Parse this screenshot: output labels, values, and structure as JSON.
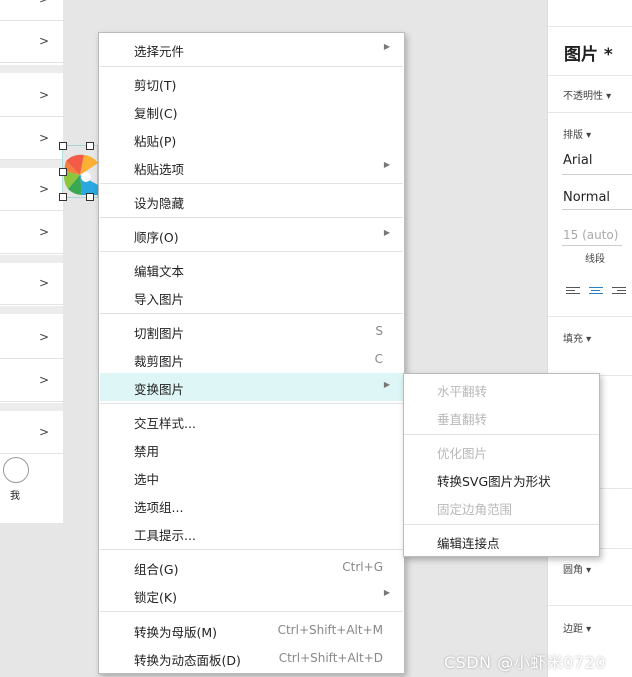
{
  "left_list": {
    "rows": [
      ">",
      ">",
      ">",
      ">",
      ">",
      ">",
      ">",
      ">",
      ">",
      ">"
    ],
    "me_label": "我"
  },
  "context_menu": {
    "items": [
      {
        "label": "选择元件",
        "shortcut": "",
        "submenu": true
      },
      {
        "label": "剪切(T)",
        "shortcut": "",
        "submenu": false
      },
      {
        "label": "复制(C)",
        "shortcut": "",
        "submenu": false
      },
      {
        "label": "粘贴(P)",
        "shortcut": "",
        "submenu": false
      },
      {
        "label": "粘贴选项",
        "shortcut": "",
        "submenu": true
      },
      {
        "label": "设为隐藏",
        "shortcut": "",
        "submenu": false
      },
      {
        "label": "顺序(O)",
        "shortcut": "",
        "submenu": true
      },
      {
        "label": "编辑文本",
        "shortcut": "",
        "submenu": false
      },
      {
        "label": "导入图片",
        "shortcut": "",
        "submenu": false
      },
      {
        "label": "切割图片",
        "shortcut": "S",
        "submenu": false
      },
      {
        "label": "裁剪图片",
        "shortcut": "C",
        "submenu": false
      },
      {
        "label": "变换图片",
        "shortcut": "",
        "submenu": true
      },
      {
        "label": "交互样式...",
        "shortcut": "",
        "submenu": false
      },
      {
        "label": "禁用",
        "shortcut": "",
        "submenu": false
      },
      {
        "label": "选中",
        "shortcut": "",
        "submenu": false
      },
      {
        "label": "选项组...",
        "shortcut": "",
        "submenu": false
      },
      {
        "label": "工具提示...",
        "shortcut": "",
        "submenu": false
      },
      {
        "label": "组合(G)",
        "shortcut": "Ctrl+G",
        "submenu": false
      },
      {
        "label": "锁定(K)",
        "shortcut": "",
        "submenu": true
      },
      {
        "label": "转换为母版(M)",
        "shortcut": "Ctrl+Shift+Alt+M",
        "submenu": false
      },
      {
        "label": "转换为动态面板(D)",
        "shortcut": "Ctrl+Shift+Alt+D",
        "submenu": false
      }
    ],
    "submenu_arrow": "▶"
  },
  "submenu": {
    "items": [
      {
        "label": "水平翻转",
        "disabled": true
      },
      {
        "label": "垂直翻转",
        "disabled": true
      },
      {
        "label": "优化图片",
        "disabled": true
      },
      {
        "label": "转换SVG图片为形状",
        "disabled": false
      },
      {
        "label": "固定边角范围",
        "disabled": true
      },
      {
        "label": "编辑连接点",
        "disabled": false
      }
    ]
  },
  "right_panel": {
    "title": "图片 *",
    "opacity_label": "不透明性 ▾",
    "typography_label": "排版 ▾",
    "font_family": "Arial",
    "font_weight": "Normal",
    "line_spacing_value": "15 (auto)",
    "line_spacing_label": "线段",
    "fill_label": "填充 ▾",
    "corner_label": "圆角 ▾",
    "margin_label": "边距 ▾"
  },
  "watermark": "CSDN @小虾米0720",
  "colors": {
    "highlight": "#dff6f6",
    "accent": "#2a7fc1"
  }
}
